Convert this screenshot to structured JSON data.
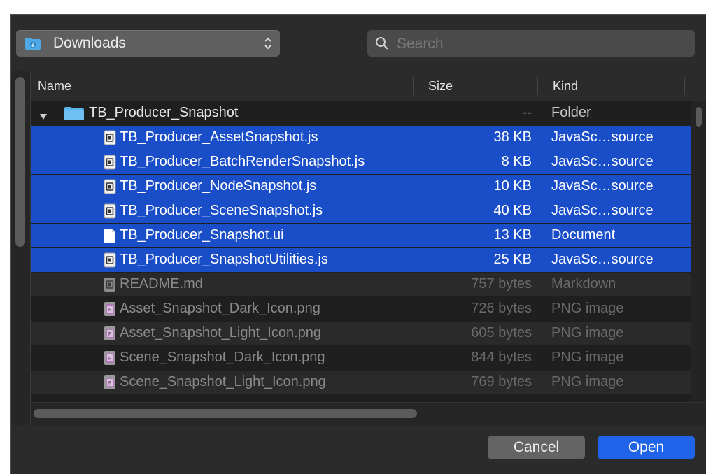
{
  "location": {
    "label": "Downloads",
    "icon": "downloads-folder-icon"
  },
  "search": {
    "placeholder": "Search",
    "value": ""
  },
  "columns": {
    "name": "Name",
    "size": "Size",
    "kind": "Kind"
  },
  "files": [
    {
      "name": "TB_Producer_Snapshot",
      "size": "--",
      "kind": "Folder",
      "icon": "folder-icon",
      "state": "folder",
      "expanded": true
    },
    {
      "name": "TB_Producer_AssetSnapshot.js",
      "size": "38 KB",
      "kind": "JavaSc…source",
      "icon": "js-file-icon",
      "state": "selected"
    },
    {
      "name": "TB_Producer_BatchRenderSnapshot.js",
      "size": "8 KB",
      "kind": "JavaSc…source",
      "icon": "js-file-icon",
      "state": "selected"
    },
    {
      "name": "TB_Producer_NodeSnapshot.js",
      "size": "10 KB",
      "kind": "JavaSc…source",
      "icon": "js-file-icon",
      "state": "selected"
    },
    {
      "name": "TB_Producer_SceneSnapshot.js",
      "size": "40 KB",
      "kind": "JavaSc…source",
      "icon": "js-file-icon",
      "state": "selected"
    },
    {
      "name": "TB_Producer_Snapshot.ui",
      "size": "13 KB",
      "kind": "Document",
      "icon": "document-icon",
      "state": "selected"
    },
    {
      "name": "TB_Producer_SnapshotUtilities.js",
      "size": "25 KB",
      "kind": "JavaSc…source",
      "icon": "js-file-icon",
      "state": "selected"
    },
    {
      "name": "README.md",
      "size": "757 bytes",
      "kind": "Markdown",
      "icon": "markdown-file-icon",
      "state": "dim"
    },
    {
      "name": "Asset_Snapshot_Dark_Icon.png",
      "size": "726 bytes",
      "kind": "PNG image",
      "icon": "png-file-icon",
      "state": "dim"
    },
    {
      "name": "Asset_Snapshot_Light_Icon.png",
      "size": "605 bytes",
      "kind": "PNG image",
      "icon": "png-file-icon",
      "state": "dim"
    },
    {
      "name": "Scene_Snapshot_Dark_Icon.png",
      "size": "844 bytes",
      "kind": "PNG image",
      "icon": "png-file-icon",
      "state": "dim"
    },
    {
      "name": "Scene_Snapshot_Light_Icon.png",
      "size": "769 bytes",
      "kind": "PNG image",
      "icon": "png-file-icon",
      "state": "dim"
    }
  ],
  "buttons": {
    "cancel": "Cancel",
    "open": "Open"
  },
  "colors": {
    "selection": "#1a4ec8",
    "primary_button": "#1e63e8",
    "dialog_background": "#2b2b2b"
  }
}
